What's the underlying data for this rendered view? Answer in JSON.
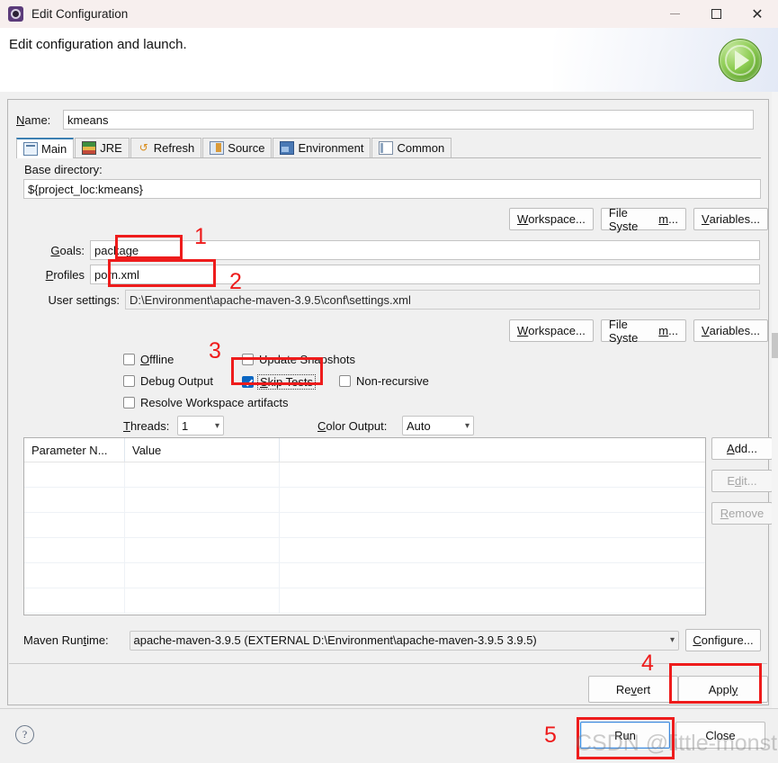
{
  "window": {
    "title": "Edit Configuration",
    "icon": "maven-config-icon",
    "minimize": "–",
    "maximize": "□",
    "close": "✕"
  },
  "header": {
    "message": "Edit configuration and launch.",
    "launch_icon": "green-run-play-icon"
  },
  "name": {
    "label": "Name:",
    "value": "kmeans"
  },
  "tabs": [
    {
      "label": "Main",
      "icon": "main-tab-icon",
      "active": true
    },
    {
      "label": "JRE",
      "icon": "jre-tab-icon",
      "active": false
    },
    {
      "label": "Refresh",
      "icon": "refresh-tab-icon",
      "active": false
    },
    {
      "label": "Source",
      "icon": "source-tab-icon",
      "active": false
    },
    {
      "label": "Environment",
      "icon": "environment-tab-icon",
      "active": false
    },
    {
      "label": "Common",
      "icon": "common-tab-icon",
      "active": false
    }
  ],
  "main": {
    "base_directory_label": "Base directory:",
    "base_directory_value": "${project_loc:kmeans}",
    "browse_buttons": [
      "Workspace...",
      "File System...",
      "Variables..."
    ],
    "goals_label": "Goals:",
    "goals_value": "package",
    "profiles_label": "Profiles",
    "profiles_value": "porn.xml",
    "user_settings_label": "User settings:",
    "user_settings_value": "D:\\Environment\\apache-maven-3.9.5\\conf\\settings.xml",
    "browse_buttons2": [
      "Workspace...",
      "File System...",
      "Variables..."
    ],
    "checkboxes": [
      {
        "label": "Offline",
        "checked": false
      },
      {
        "label": "Update Snapshots",
        "checked": false
      },
      {
        "label": "Debug Output",
        "checked": false
      },
      {
        "label": "Skip Tests",
        "checked": true
      },
      {
        "label": "Non-recursive",
        "checked": false
      },
      {
        "label": "Resolve Workspace artifacts",
        "checked": false
      }
    ],
    "threads_label": "Threads:",
    "threads_value": "1",
    "color_output_label": "Color Output:",
    "color_output_value": "Auto",
    "table": {
      "columns": [
        "Parameter N...",
        "Value",
        ""
      ],
      "rows": [],
      "empty_row_count": 6
    },
    "table_buttons": [
      {
        "label": "Add...",
        "enabled": true
      },
      {
        "label": "Edit...",
        "enabled": false
      },
      {
        "label": "Remove",
        "enabled": false
      }
    ],
    "maven_runtime_label": "Maven Runtime:",
    "maven_runtime_value": "apache-maven-3.9.5 (EXTERNAL D:\\Environment\\apache-maven-3.9.5 3.9.5)",
    "configure_label": "Configure..."
  },
  "footer": {
    "revert": "Revert",
    "apply": "Apply",
    "run": "Run",
    "close": "Close",
    "help_icon": "help-question-icon"
  },
  "annotations": {
    "n1": "1",
    "n2": "2",
    "n3": "3",
    "n4": "4",
    "n5": "5"
  },
  "watermark": "CSDN @little-monster",
  "colors": {
    "annotation_red": "#ee1c1c",
    "titlebar": "#f7efee",
    "accent_blue": "#0a66c2",
    "launch_green": "#8fce54"
  }
}
